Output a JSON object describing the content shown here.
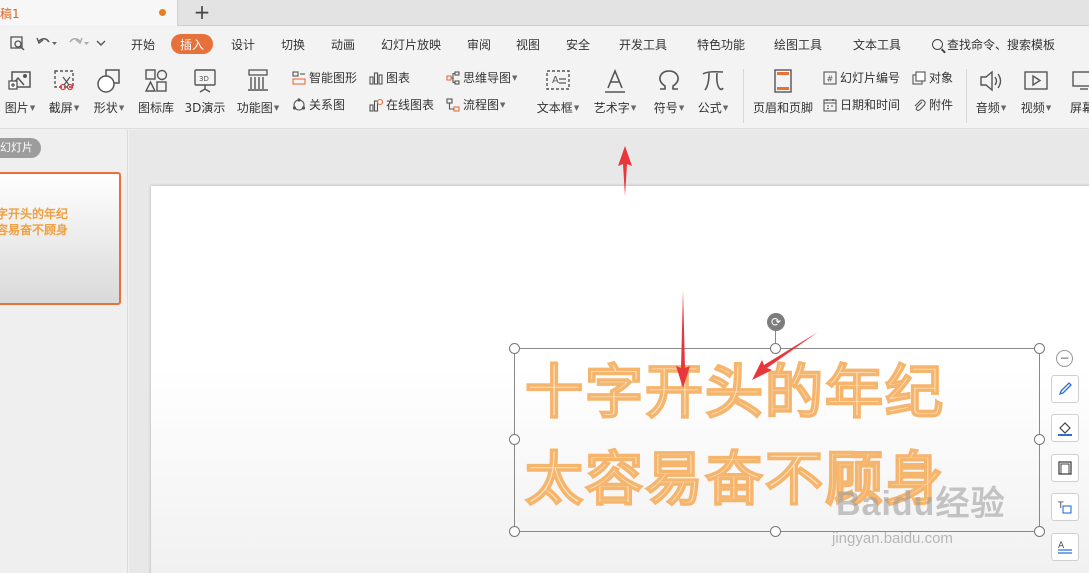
{
  "tabbar": {
    "doc_title": "稿1",
    "new_tab_symbol": "+"
  },
  "quick_access": {
    "icons": [
      "print-preview-icon",
      "undo-icon",
      "redo-icon",
      "customize-icon"
    ]
  },
  "menu": {
    "items": [
      "开始",
      "插入",
      "设计",
      "切换",
      "动画",
      "幻灯片放映",
      "审阅",
      "视图",
      "安全",
      "开发工具",
      "特色功能",
      "绘图工具",
      "文本工具"
    ],
    "active": "插入",
    "search_label": "查找命令、搜索模板"
  },
  "ribbon": {
    "picture": "图片",
    "screenshot": "截屏",
    "shape": "形状",
    "icon_library": "图标库",
    "demo3d": "3D演示",
    "function_chart": "功能图",
    "smart_graphic": "智能图形",
    "chart": "图表",
    "relation_chart": "关系图",
    "online_chart": "在线图表",
    "mind_map": "思维导图",
    "flowchart": "流程图",
    "textbox": "文本框",
    "wordart": "艺术字",
    "symbol": "符号",
    "formula": "公式",
    "header_footer": "页眉和页脚",
    "slide_number": "幻灯片编号",
    "object": "对象",
    "date_time": "日期和时间",
    "attachment": "附件",
    "audio": "音频",
    "video": "视频",
    "screen": "屏幕"
  },
  "left_panel": {
    "tab_label": "幻灯片",
    "thumbnail_lines": [
      "十字开头的年纪",
      "太容易奋不顾身"
    ]
  },
  "slide": {
    "art_lines": [
      "十字开头的年纪",
      "太容易奋不顾身"
    ]
  },
  "watermark": {
    "logo": "Baidu经验",
    "url": "jingyan.baidu.com"
  },
  "colors": {
    "accent": "#e8703a",
    "arrow": "#e8363b",
    "art_fill": "#fde4c4",
    "art_stroke": "#f6b56c"
  }
}
